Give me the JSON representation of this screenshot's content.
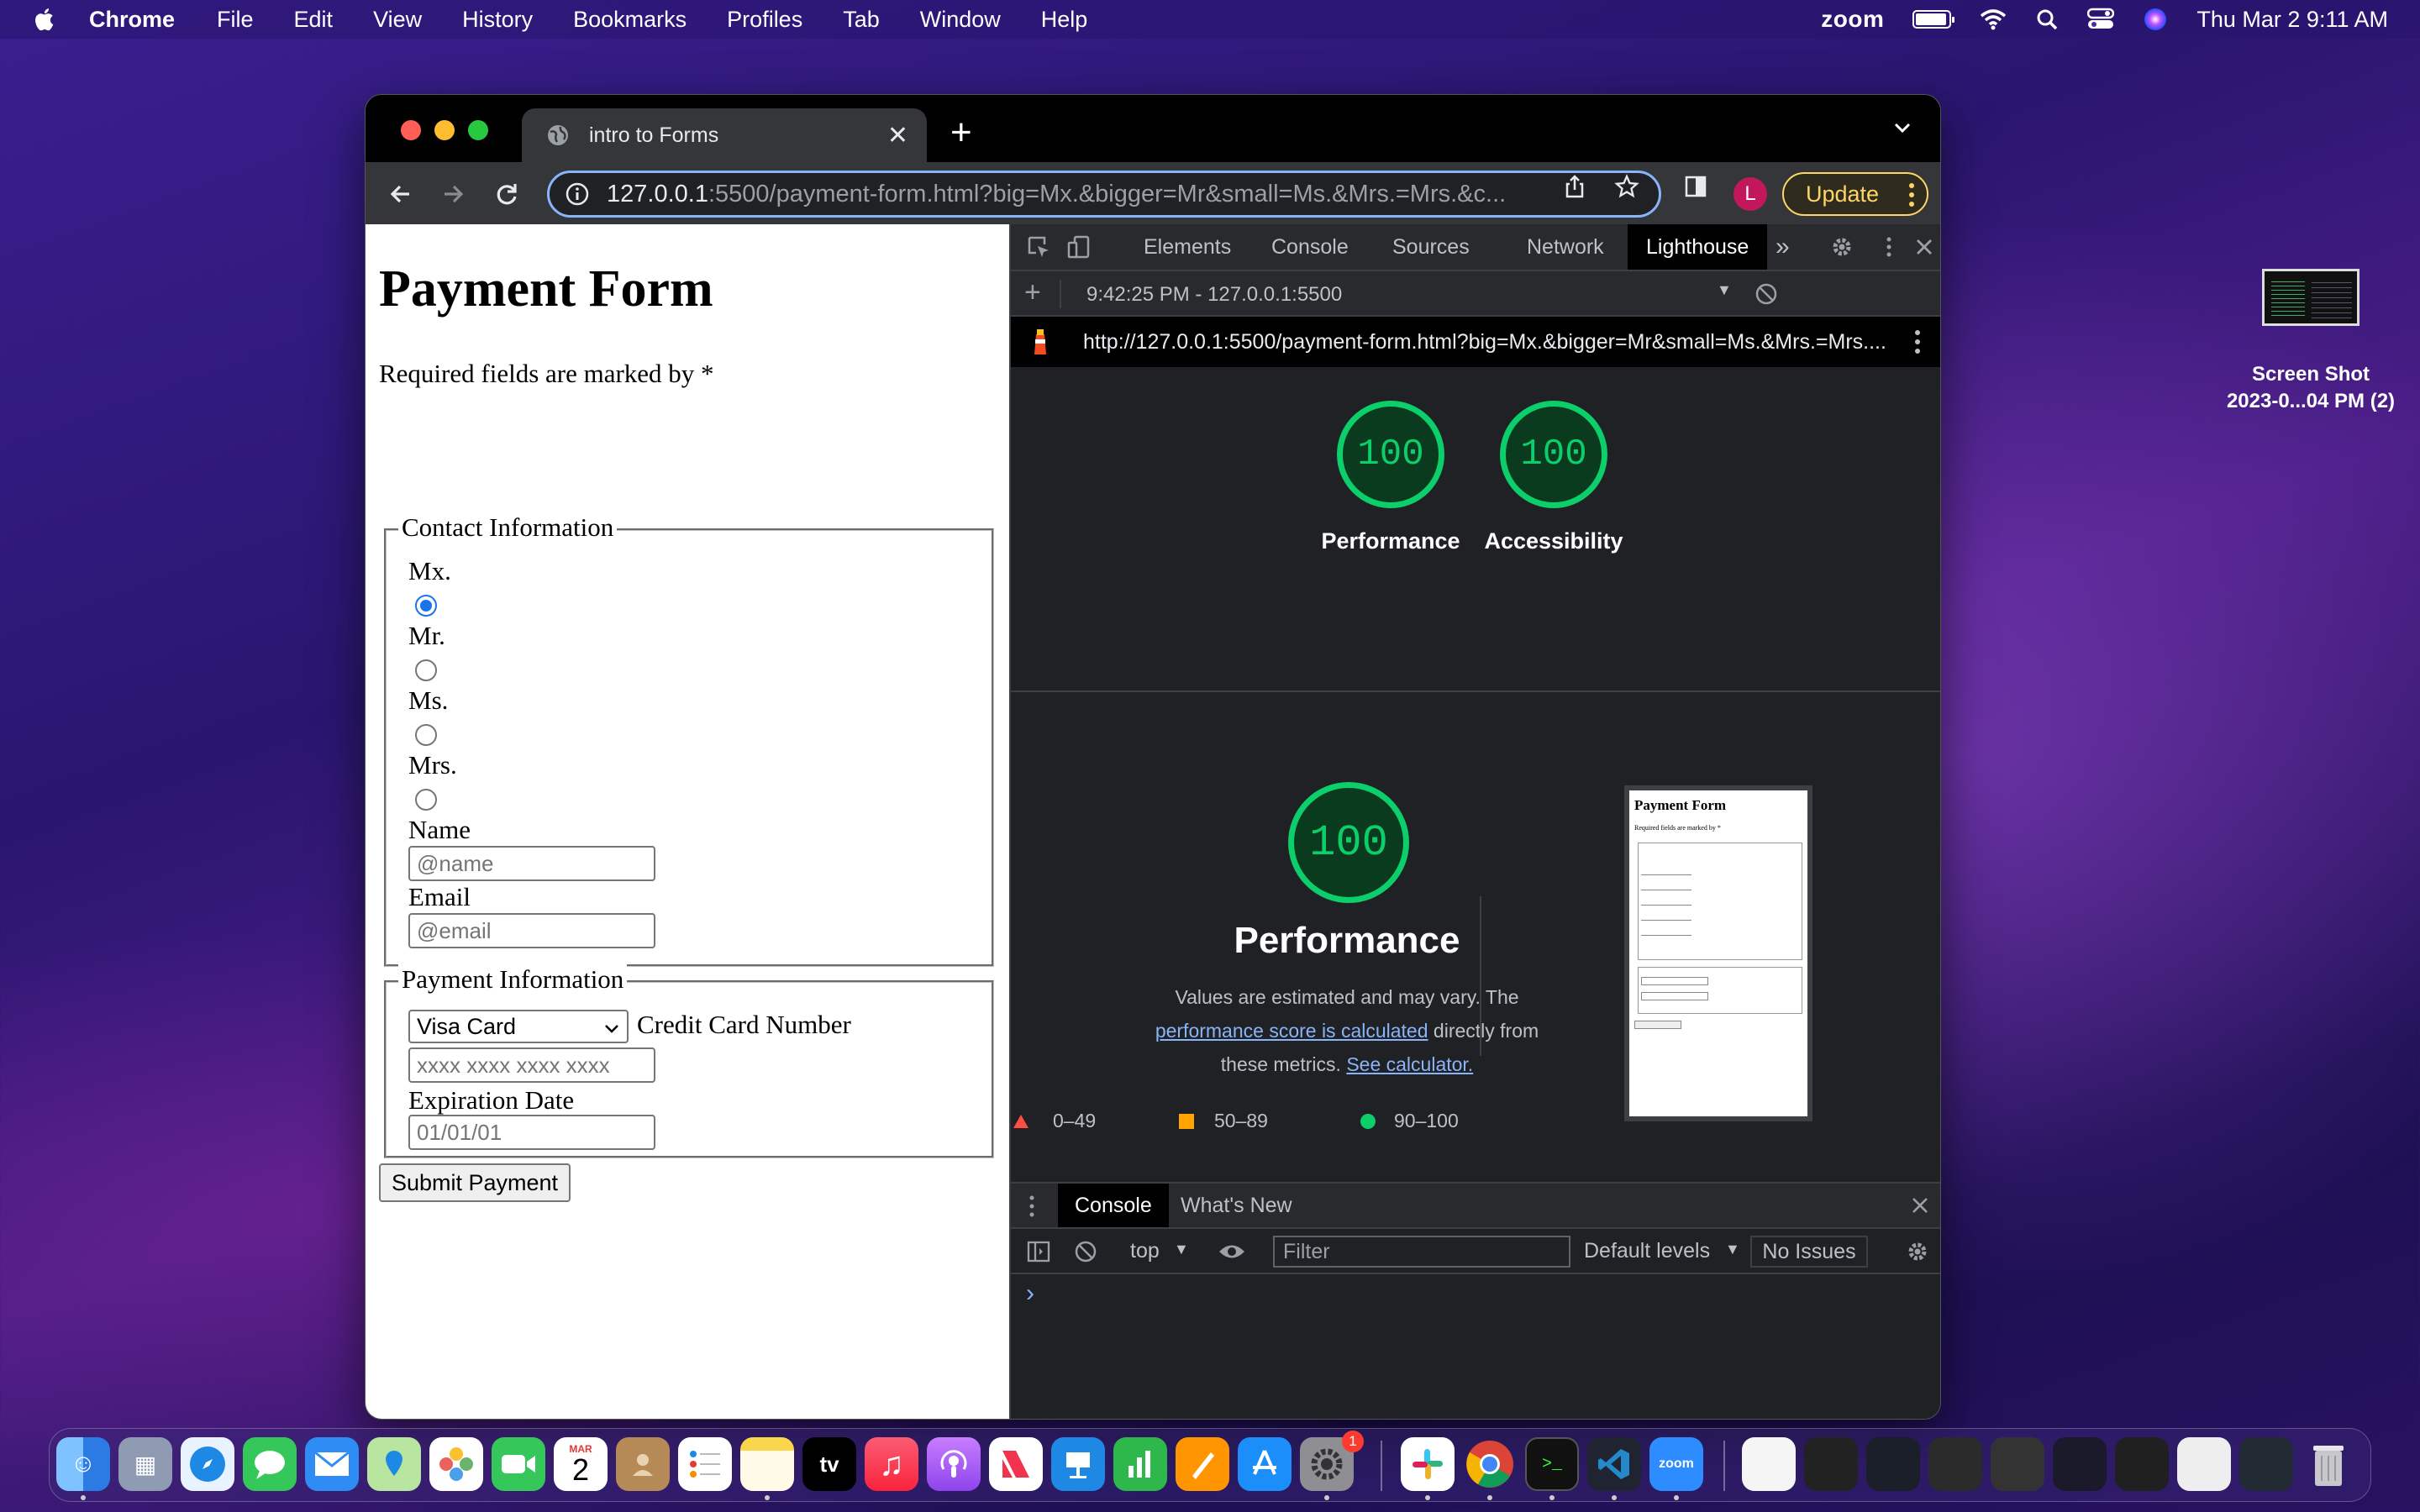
{
  "menubar": {
    "app_name": "Chrome",
    "menus": [
      "File",
      "Edit",
      "View",
      "History",
      "Bookmarks",
      "Profiles",
      "Tab",
      "Window",
      "Help"
    ],
    "zoom_label": "zoom",
    "datetime": "Thu Mar 2  9:11 AM"
  },
  "browser": {
    "tab_title": "intro to Forms",
    "url_host": "127.0.0.1",
    "url_rest": ":5500/payment-form.html?big=Mx.&bigger=Mr&small=Ms.&Mrs.=Mrs.&c...",
    "profile_initial": "L",
    "update_label": "Update"
  },
  "page": {
    "title": "Payment Form",
    "required_note": "Required fields are marked by *",
    "contact": {
      "legend": "Contact Information",
      "radios": [
        {
          "label": "Mx.",
          "checked": true
        },
        {
          "label": "Mr.",
          "checked": false
        },
        {
          "label": "Ms.",
          "checked": false
        },
        {
          "label": "Mrs.",
          "checked": false
        }
      ],
      "name_label": "Name",
      "name_placeholder": "@name",
      "email_label": "Email",
      "email_placeholder": "@email"
    },
    "payment": {
      "legend": "Payment Information",
      "card_select": "Visa Card",
      "cc_label": "Credit Card Number",
      "cc_placeholder": "xxxx xxxx xxxx xxxx",
      "exp_label": "Expiration Date",
      "exp_placeholder": "01/01/01"
    },
    "submit_label": "Submit Payment"
  },
  "devtools": {
    "tabs": [
      "Elements",
      "Console",
      "Sources",
      "Network",
      "Lighthouse"
    ],
    "active_tab": "Lighthouse",
    "report_time": "9:42:25 PM - 127.0.0.1:5500",
    "report_url": "http://127.0.0.1:5500/payment-form.html?big=Mx.&bigger=Mr&small=Ms.&Mrs.=Mrs....",
    "scores": [
      {
        "label": "Performance",
        "value": "100"
      },
      {
        "label": "Accessibility",
        "value": "100"
      }
    ],
    "perf_big": {
      "value": "100",
      "label": "Performance"
    },
    "perf_desc_1": "Values are estimated and may vary. The",
    "perf_link_1": "performance score is calculated",
    "perf_desc_2": "directly from",
    "perf_desc_3": "these metrics.",
    "perf_link_2": "See calculator.",
    "legend": [
      {
        "range": "0–49",
        "color": "#ff4e42"
      },
      {
        "range": "50–89",
        "color": "#ffa400"
      },
      {
        "range": "90–100",
        "color": "#0cce6b"
      }
    ],
    "drawer": {
      "tabs": [
        "Console",
        "What's New"
      ],
      "context": "top",
      "filter_placeholder": "Filter",
      "levels": "Default levels",
      "issues": "No Issues",
      "prompt": "›"
    }
  },
  "thumbnail": {
    "title": "Payment Form",
    "note": "Required fields are marked by *"
  },
  "desktop": {
    "file_label_1": "Screen Shot",
    "file_label_2": "2023-0...04 PM (2)"
  },
  "dock": {
    "calendar_month": "MAR",
    "calendar_day": "2",
    "tv_label": "tv",
    "zoom_label": "zoom",
    "settings_badge": "1"
  },
  "colors": {
    "score_good": "#0cce6b",
    "omnibox_focus": "#8ab4f8",
    "update_accent": "#fdd663"
  }
}
